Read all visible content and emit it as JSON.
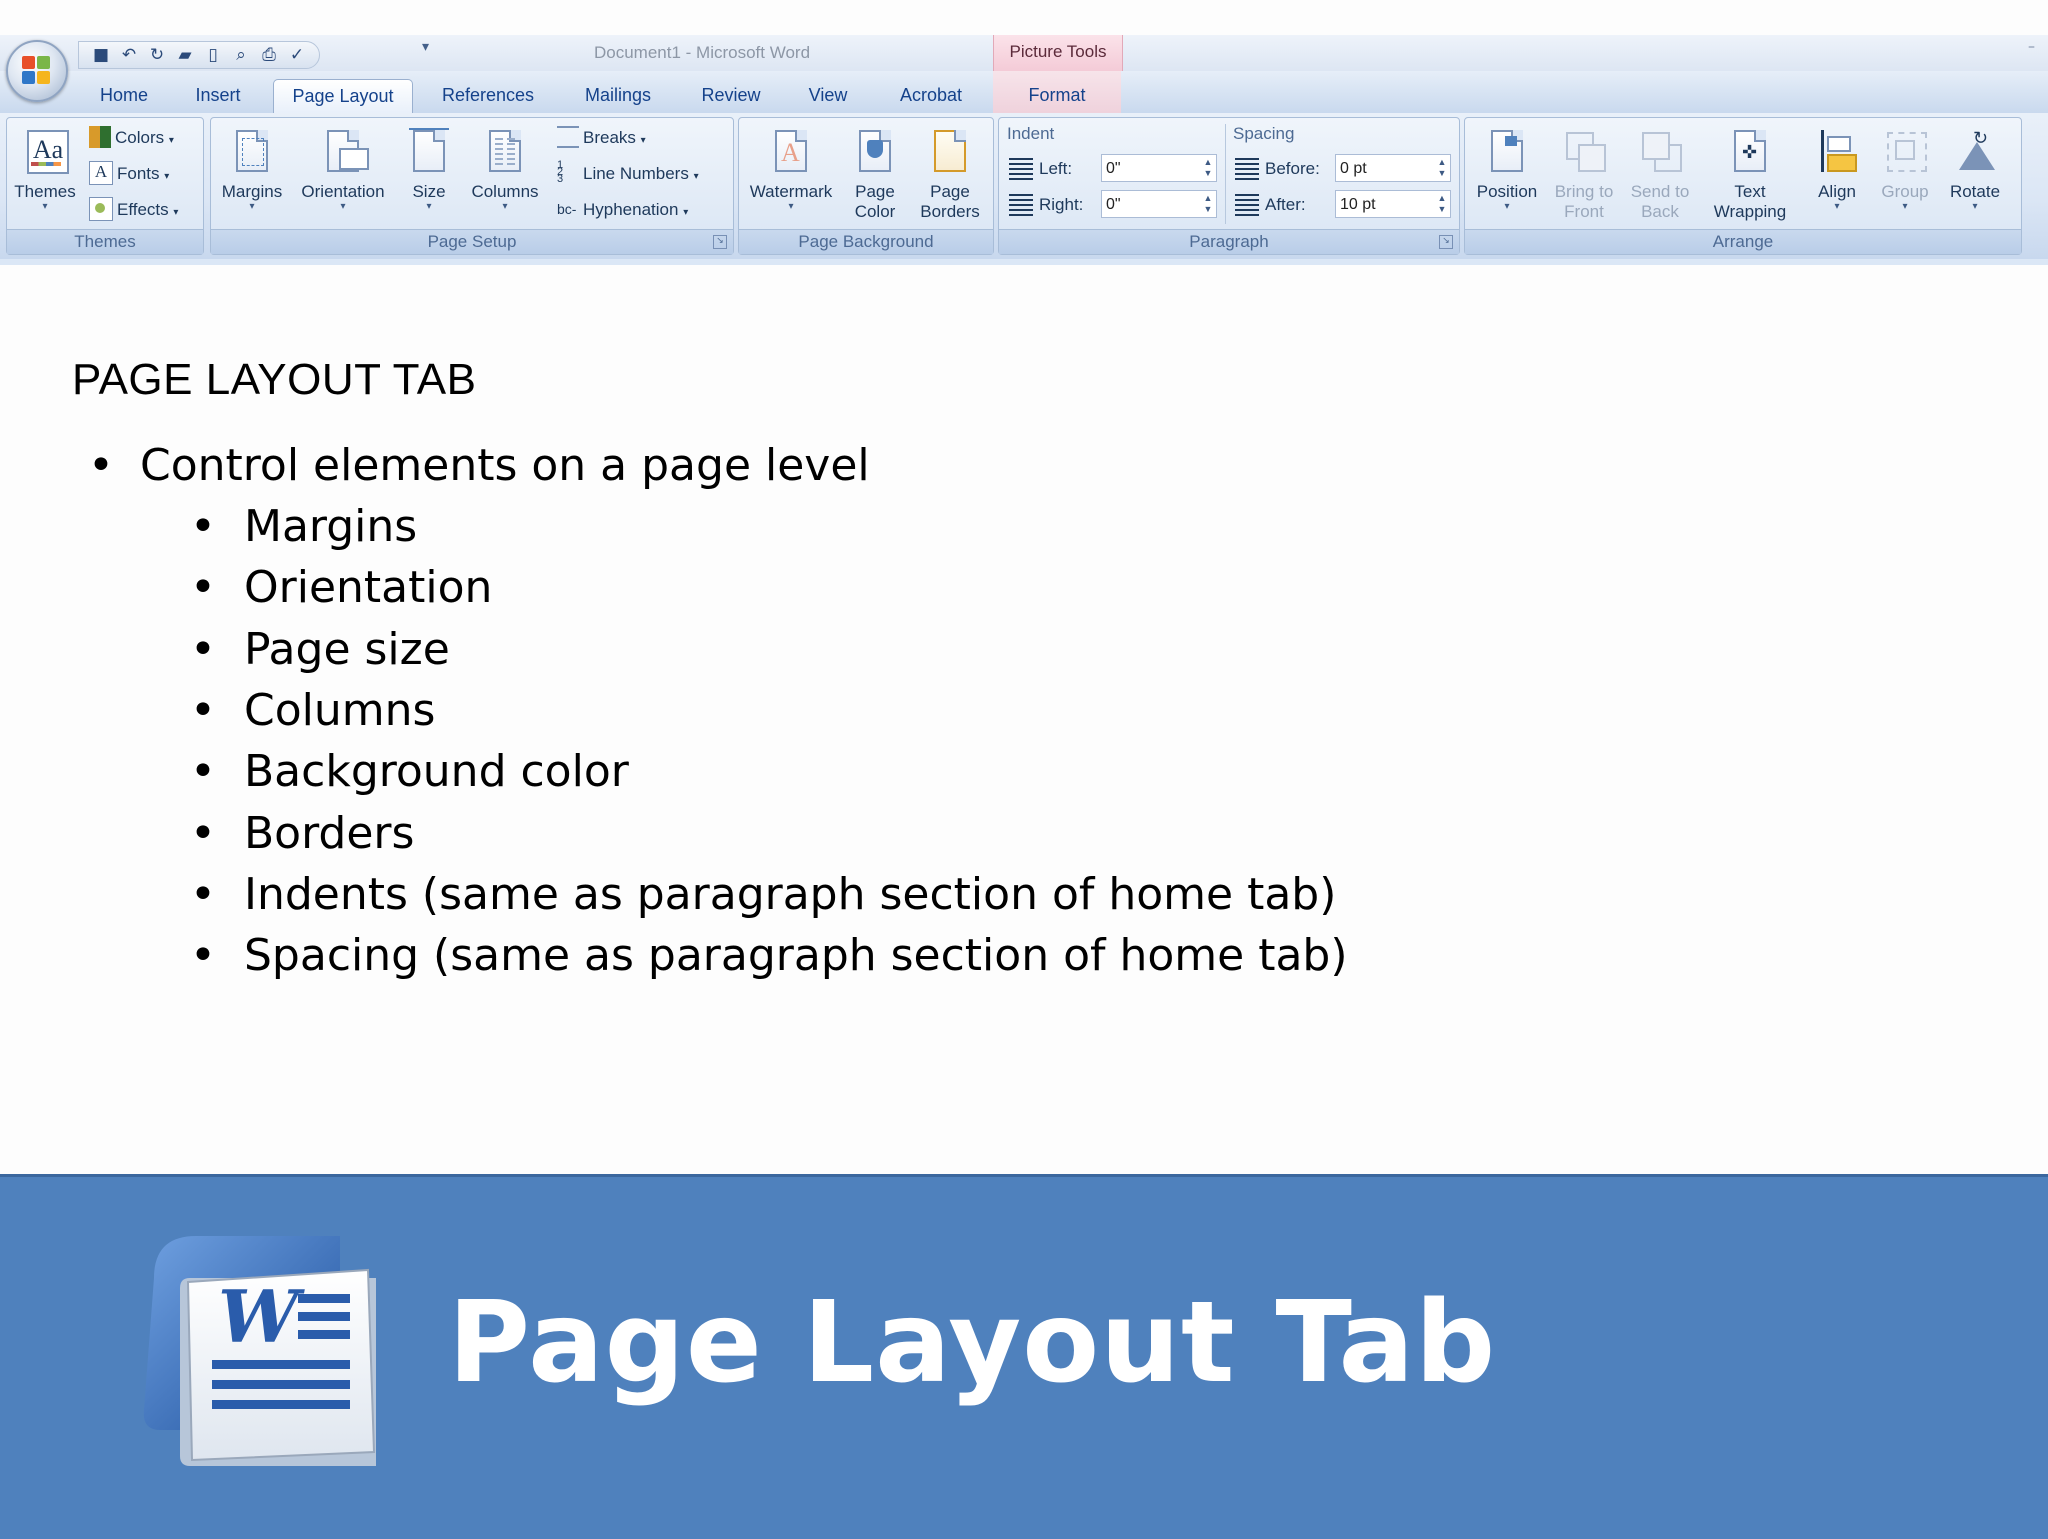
{
  "window": {
    "title": "Document1 - Microsoft Word",
    "context_tab_title": "Picture Tools"
  },
  "tabs": [
    {
      "label": "Home"
    },
    {
      "label": "Insert"
    },
    {
      "label": "Page Layout",
      "active": true
    },
    {
      "label": "References"
    },
    {
      "label": "Mailings"
    },
    {
      "label": "Review"
    },
    {
      "label": "View"
    },
    {
      "label": "Acrobat"
    },
    {
      "label": "Format"
    }
  ],
  "ribbon": {
    "themes": {
      "group_label": "Themes",
      "themes_button": "Themes",
      "colors": "Colors",
      "fonts": "Fonts",
      "effects": "Effects"
    },
    "page_setup": {
      "group_label": "Page Setup",
      "margins": "Margins",
      "orientation": "Orientation",
      "size": "Size",
      "columns": "Columns",
      "breaks": "Breaks",
      "line_numbers": "Line Numbers",
      "hyphenation": "Hyphenation"
    },
    "page_background": {
      "group_label": "Page Background",
      "watermark": "Watermark",
      "page_color_1": "Page",
      "page_color_2": "Color",
      "page_borders_1": "Page",
      "page_borders_2": "Borders"
    },
    "paragraph": {
      "group_label": "Paragraph",
      "indent_title": "Indent",
      "left_label": "Left:",
      "left_value": "0\"",
      "right_label": "Right:",
      "right_value": "0\"",
      "spacing_title": "Spacing",
      "before_label": "Before:",
      "before_value": "0 pt",
      "after_label": "After:",
      "after_value": "10 pt"
    },
    "arrange": {
      "group_label": "Arrange",
      "position": "Position",
      "bring_to_front_1": "Bring to",
      "bring_to_front_2": "Front",
      "send_to_back_1": "Send to",
      "send_to_back_2": "Back",
      "text_wrapping_1": "Text",
      "text_wrapping_2": "Wrapping",
      "align": "Align",
      "group": "Group",
      "rotate": "Rotate"
    }
  },
  "slide": {
    "heading": "PAGE LAYOUT TAB",
    "bullet_main": "Control elements on a page level",
    "sub_bullets": [
      "Margins",
      "Orientation",
      "Page size",
      "Columns",
      "Background color",
      "Borders",
      "Indents (same as paragraph section of home tab)",
      "Spacing (same as paragraph section of home tab)"
    ],
    "bullet_symbol": "•",
    "banner_title": "Page Layout Tab"
  },
  "colors": {
    "banner": "#4f81bd",
    "ribbon_text": "#15428b",
    "context_tab": "#f4cbd7"
  }
}
